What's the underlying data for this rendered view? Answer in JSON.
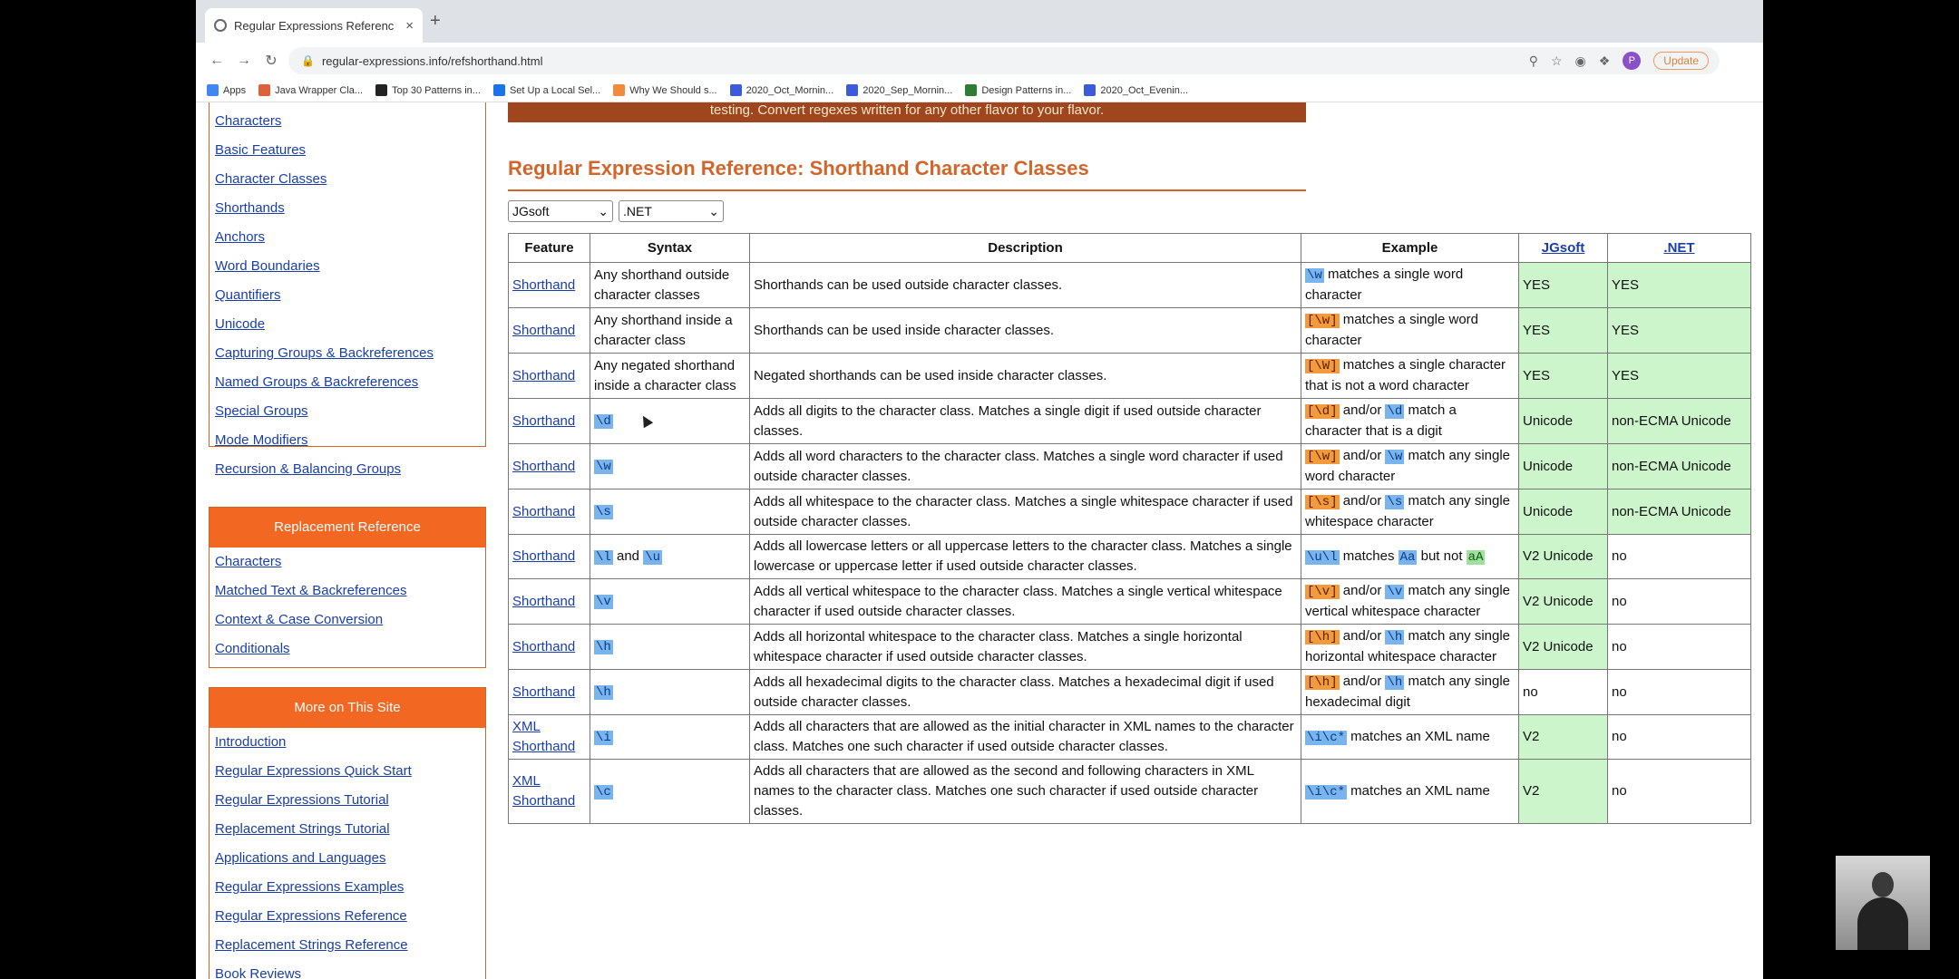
{
  "browser": {
    "tab_title": "Regular Expressions Referenc",
    "tab_close": "×",
    "new_tab": "+",
    "url": "regular-expressions.info/refshorthand.html",
    "update_label": "Update",
    "profile_initial": "P",
    "bookmarks": [
      {
        "label": "Apps",
        "color": "#4285f4"
      },
      {
        "label": "Java Wrapper Cla...",
        "color": "#e0603a"
      },
      {
        "label": "Top 30 Patterns in...",
        "color": "#222222"
      },
      {
        "label": "Set Up a Local Sel...",
        "color": "#1a73e8"
      },
      {
        "label": "Why We Should s...",
        "color": "#f08a3c"
      },
      {
        "label": "2020_Oct_Mornin...",
        "color": "#3b5bdb"
      },
      {
        "label": "2020_Sep_Mornin...",
        "color": "#3b5bdb"
      },
      {
        "label": "Design Patterns in...",
        "color": "#2e7d32"
      },
      {
        "label": "2020_Oct_Evenin...",
        "color": "#3b5bdb"
      }
    ]
  },
  "sidebar": {
    "top_links": [
      "Characters",
      "Basic Features",
      "Character Classes",
      "Shorthands",
      "Anchors",
      "Word Boundaries",
      "Quantifiers",
      "Unicode",
      "Capturing Groups & Backreferences",
      "Named Groups & Backreferences",
      "Special Groups",
      "Mode Modifiers",
      "Recursion & Balancing Groups"
    ],
    "replacement_heading": "Replacement Reference",
    "replacement_links": [
      "Characters",
      "Matched Text & Backreferences",
      "Context & Case Conversion",
      "Conditionals"
    ],
    "more_heading": "More on This Site",
    "more_links": [
      "Introduction",
      "Regular Expressions Quick Start",
      "Regular Expressions Tutorial",
      "Replacement Strings Tutorial",
      "Applications and Languages",
      "Regular Expressions Examples",
      "Regular Expressions Reference",
      "Replacement Strings Reference",
      "Book Reviews"
    ]
  },
  "main": {
    "banner": "testing.  Convert regexes written for any other flavor to your flavor.",
    "title": "Regular Expression Reference: Shorthand Character Classes",
    "select1": "JGsoft",
    "select2": ".NET",
    "headers": {
      "feature": "Feature",
      "syntax": "Syntax",
      "description": "Description",
      "example": "Example",
      "c1": "JGsoft",
      "c2": ".NET"
    },
    "rows": [
      {
        "feature": "Shorthand",
        "syntax": "Any shorthand outside character classes",
        "desc": "Shorthands can be used outside character classes.",
        "ex_code": "\\w",
        "ex_text": " matches a single word character",
        "j": "YES",
        "n": "YES"
      },
      {
        "feature": "Shorthand",
        "syntax": "Any shorthand inside a character class",
        "desc": "Shorthands can be used inside character classes.",
        "ex_code": "[\\w]",
        "ex_text": " matches a single word character",
        "j": "YES",
        "n": "YES"
      },
      {
        "feature": "Shorthand",
        "syntax": "Any negated shorthand inside a character class",
        "desc": "Negated shorthands can be used inside character classes.",
        "ex_code": "[\\W]",
        "ex_text": " matches a single character that is not a word character",
        "j": "YES",
        "n": "YES"
      },
      {
        "feature": "Shorthand",
        "syntax_code": "\\d",
        "desc": "Adds all digits to the character class. Matches a single digit if used outside character classes.",
        "ex_code": "[\\d]",
        "ex_mid": " and/or ",
        "ex_code2": "\\d",
        "ex_text": " match a character that is a digit",
        "j": "Unicode",
        "n": "non-ECMA Unicode"
      },
      {
        "feature": "Shorthand",
        "syntax_code": "\\w",
        "desc": "Adds all word characters to the character class. Matches a single word character if used outside character classes.",
        "ex_code": "[\\w]",
        "ex_mid": " and/or ",
        "ex_code2": "\\w",
        "ex_text": " match any single word character",
        "j": "Unicode",
        "n": "non-ECMA Unicode"
      },
      {
        "feature": "Shorthand",
        "syntax_code": "\\s",
        "desc": "Adds all whitespace to the character class. Matches a single whitespace character if used outside character classes.",
        "ex_code": "[\\s]",
        "ex_mid": " and/or ",
        "ex_code2": "\\s",
        "ex_text": " match any single whitespace character",
        "j": "Unicode",
        "n": "non-ECMA Unicode"
      },
      {
        "feature": "Shorthand",
        "syntax_code": "\\l",
        "syntax_and": " and ",
        "syntax_code2": "\\u",
        "desc": "Adds all lowercase letters or all uppercase letters to the character class. Matches a single lowercase or uppercase letter if used outside character classes.",
        "ex_code": "\\u\\l",
        "ex_text": " matches ",
        "ex_code2": "Aa",
        "ex_text2": " but not ",
        "ex_code3": "aA",
        "j": "V2 Unicode",
        "n": "no"
      },
      {
        "feature": "Shorthand",
        "syntax_code": "\\v",
        "desc": "Adds all vertical whitespace to the character class. Matches a single vertical whitespace character if used outside character classes.",
        "ex_code": "[\\v]",
        "ex_mid": " and/or ",
        "ex_code2": "\\v",
        "ex_text": " match any single vertical whitespace character",
        "j": "V2 Unicode",
        "n": "no"
      },
      {
        "feature": "Shorthand",
        "syntax_code": "\\h",
        "desc": "Adds all horizontal whitespace to the character class. Matches a single horizontal whitespace character if used outside character classes.",
        "ex_code": "[\\h]",
        "ex_mid": " and/or ",
        "ex_code2": "\\h",
        "ex_text": " match any single horizontal whitespace character",
        "j": "V2 Unicode",
        "n": "no"
      },
      {
        "feature": "Shorthand",
        "syntax_code": "\\h",
        "desc": "Adds all hexadecimal digits to the character class. Matches a hexadecimal digit if used outside character classes.",
        "ex_code": "[\\h]",
        "ex_mid": " and/or ",
        "ex_code2": "\\h",
        "ex_text": " match any single hexadecimal digit",
        "j": "no",
        "n": "no"
      },
      {
        "feature": "XML Shorthand",
        "syntax_code": "\\i",
        "desc": "Adds all characters that are allowed as the initial character in XML names to the character class. Matches one such character if used outside character classes.",
        "ex_code": "\\i\\c*",
        "ex_text": " matches an XML name",
        "j": "V2",
        "n": "no"
      },
      {
        "feature": "XML Shorthand",
        "syntax_code": "\\c",
        "desc": "Adds all characters that are allowed as the second and following characters in XML names to the character class. Matches one such character if used outside character classes.",
        "ex_code": "\\i\\c*",
        "ex_text": " matches an XML name",
        "j": "V2",
        "n": "no"
      }
    ]
  }
}
